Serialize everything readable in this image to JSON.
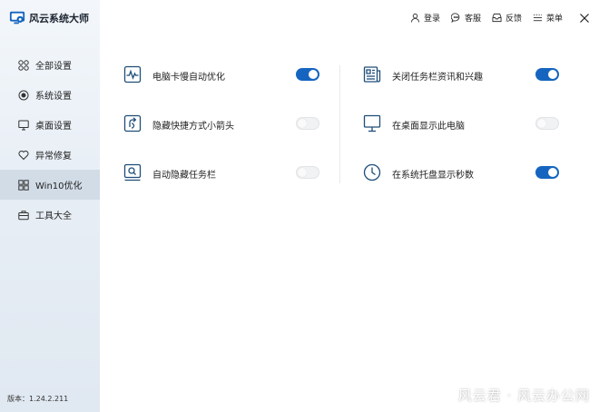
{
  "app": {
    "title": "风云系统大师",
    "version": "版本：1.24.2.211",
    "accent": "#1565c0"
  },
  "sidebar": {
    "items": [
      {
        "label": "全部设置",
        "icon": "grid-icon",
        "active": false
      },
      {
        "label": "系统设置",
        "icon": "target-icon",
        "active": false
      },
      {
        "label": "桌面设置",
        "icon": "monitor-icon",
        "active": false
      },
      {
        "label": "异常修复",
        "icon": "heart-icon",
        "active": false
      },
      {
        "label": "Win10优化",
        "icon": "windows-icon",
        "active": true
      },
      {
        "label": "工具大全",
        "icon": "toolbox-icon",
        "active": false
      }
    ]
  },
  "topbar": {
    "login": "登录",
    "service": "客服",
    "feedback": "反馈",
    "menu": "菜单"
  },
  "settings": {
    "left": [
      {
        "label": "电脑卡慢自动优化",
        "icon": "pulse-icon",
        "enabled": true
      },
      {
        "label": "隐藏快捷方式小箭头",
        "icon": "shortcut-arrow-icon",
        "enabled": false
      },
      {
        "label": "自动隐藏任务栏",
        "icon": "taskbar-icon",
        "enabled": false
      }
    ],
    "right": [
      {
        "label": "关闭任务栏资讯和兴趣",
        "icon": "news-icon",
        "enabled": true
      },
      {
        "label": "在桌面显示此电脑",
        "icon": "computer-icon",
        "enabled": false
      },
      {
        "label": "在系统托盘显示秒数",
        "icon": "clock-icon",
        "enabled": true
      }
    ]
  },
  "watermark": "风云君 · 风云办公网"
}
